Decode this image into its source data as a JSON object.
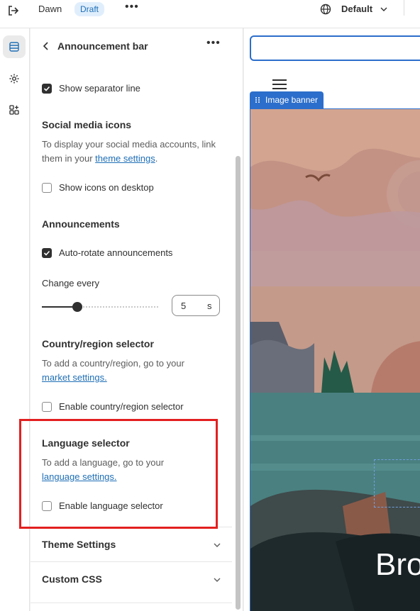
{
  "topbar": {
    "theme_name": "Dawn",
    "status_badge": "Draft",
    "more_label": "•••",
    "view_label": "Default",
    "icons": [
      "exit-icon",
      "globe-icon",
      "chevron-down-icon"
    ]
  },
  "rail": {
    "items": [
      {
        "name": "sections",
        "icon": "sections-icon",
        "active": true
      },
      {
        "name": "settings",
        "icon": "gear-icon",
        "active": false
      },
      {
        "name": "apps",
        "icon": "apps-icon",
        "active": false
      }
    ]
  },
  "panel": {
    "title": "Announcement bar",
    "more_label": "•••",
    "separator": {
      "label": "Show separator line",
      "checked": true
    },
    "social": {
      "title": "Social media icons",
      "help_text": "To display your social media accounts, link them in your ",
      "link": "theme settings",
      "help_suffix": ".",
      "checkbox": {
        "label": "Show icons on desktop",
        "checked": false
      }
    },
    "announcements": {
      "title": "Announcements",
      "autorotate": {
        "label": "Auto-rotate announcements",
        "checked": true
      },
      "change_every_label": "Change every",
      "slider_level_percent": 30,
      "value": "5",
      "unit": "s"
    },
    "country": {
      "title": "Country/region selector",
      "help_text": "To add a country/region, go to your ",
      "link": "market settings.",
      "checkbox": {
        "label": "Enable country/region selector",
        "checked": false
      }
    },
    "language": {
      "title": "Language selector",
      "help_text": "To add a language, go to your ",
      "link": "language settings.",
      "checkbox": {
        "label": "Enable language selector",
        "checked": false
      }
    },
    "accordions": [
      "Theme Settings",
      "Custom CSS"
    ]
  },
  "preview": {
    "banner_tag": "Image banner",
    "banner_heading_partial": "Bro",
    "colors": {
      "accent": "#2c6ecb",
      "highlight": "#e32020"
    }
  }
}
